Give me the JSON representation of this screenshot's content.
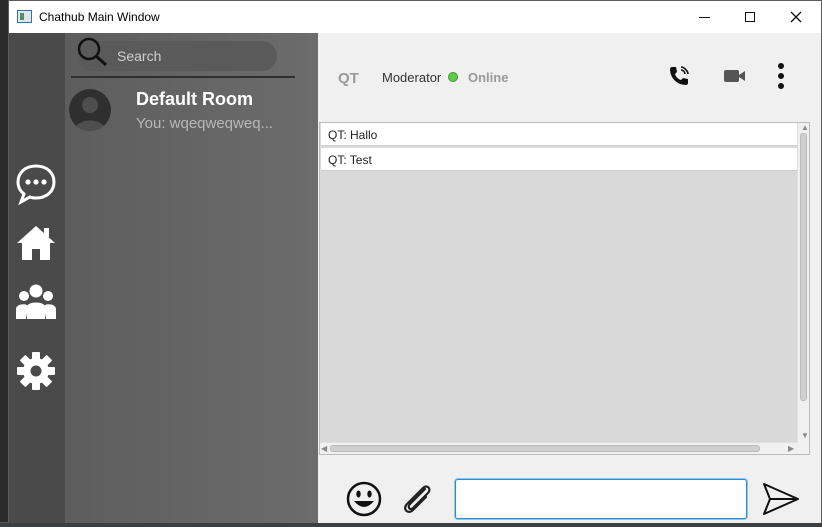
{
  "window": {
    "title": "Chathub Main Window"
  },
  "rail": {
    "items": [
      {
        "icon": "chat-bubble-icon"
      },
      {
        "icon": "home-icon"
      },
      {
        "icon": "group-icon"
      },
      {
        "icon": "gear-icon"
      }
    ]
  },
  "rooms": {
    "search_placeholder": "Search",
    "items": [
      {
        "name": "Default Room",
        "last_message": "You: wqeqweqweq..."
      }
    ]
  },
  "chat": {
    "user": "QT",
    "role": "Moderator",
    "status": "Online",
    "status_color": "#5ccc47",
    "messages": [
      {
        "text": "QT: Hallo"
      },
      {
        "text": "QT: Test"
      }
    ],
    "input_value": ""
  },
  "colors": {
    "rail": "#4a4a4a",
    "rooms_panel": "#656565",
    "input_focus": "#2a8fd4"
  }
}
